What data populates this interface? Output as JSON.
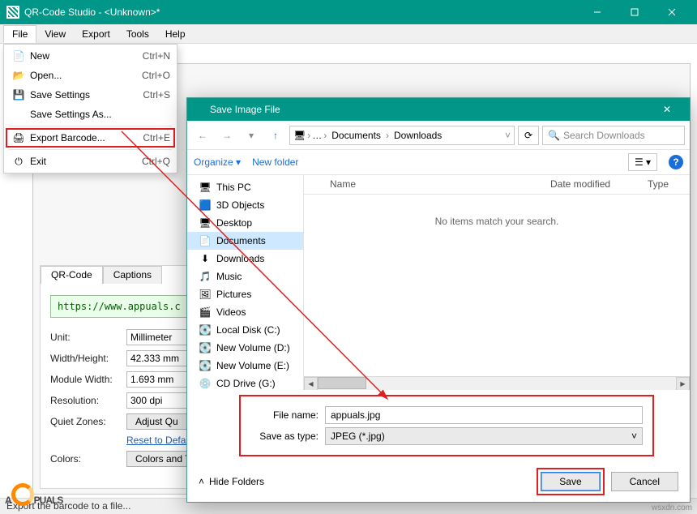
{
  "titlebar": {
    "title": "QR-Code Studio - <Unknown>*"
  },
  "menubar": [
    "File",
    "View",
    "Export",
    "Tools",
    "Help"
  ],
  "filemenu": {
    "new": "New",
    "new_sc": "Ctrl+N",
    "open": "Open...",
    "open_sc": "Ctrl+O",
    "save": "Save Settings",
    "save_sc": "Ctrl+S",
    "saveas": "Save Settings As...",
    "export": "Export Barcode...",
    "export_sc": "Ctrl+E",
    "exit": "Exit",
    "exit_sc": "Ctrl+Q"
  },
  "tabs": {
    "qr": "QR-Code",
    "cap": "Captions"
  },
  "url": "https://www.appuals.c",
  "props": {
    "unit_l": "Unit:",
    "unit_v": "Millimeter",
    "wh_l": "Width/Height:",
    "wh_v": "42.333 mm",
    "mw_l": "Module Width:",
    "mw_v": "1.693 mm",
    "res_l": "Resolution:",
    "res_v": "300 dpi",
    "qz_l": "Quiet Zones:",
    "qz_btn": "Adjust Qu",
    "reset": "Reset to Default Se",
    "col_l": "Colors:",
    "col_btn": "Colors and T"
  },
  "status": "Export the barcode to a file...",
  "dialog": {
    "title": "Save Image File",
    "crumbs": [
      "Documents",
      "Downloads"
    ],
    "search_ph": "Search Downloads",
    "organize": "Organize",
    "newfolder": "New folder",
    "cols": {
      "name": "Name",
      "date": "Date modified",
      "type": "Type"
    },
    "empty": "No items match your search.",
    "fn_l": "File name:",
    "fn_v": "appuals.jpg",
    "st_l": "Save as type:",
    "st_v": "JPEG (*.jpg)",
    "hide": "Hide Folders",
    "save": "Save",
    "cancel": "Cancel",
    "tree": [
      {
        "k": "thispc",
        "label": "This PC"
      },
      {
        "k": "3d",
        "label": "3D Objects"
      },
      {
        "k": "desktop",
        "label": "Desktop"
      },
      {
        "k": "documents",
        "label": "Documents"
      },
      {
        "k": "downloads",
        "label": "Downloads"
      },
      {
        "k": "music",
        "label": "Music"
      },
      {
        "k": "pictures",
        "label": "Pictures"
      },
      {
        "k": "videos",
        "label": "Videos"
      },
      {
        "k": "ldc",
        "label": "Local Disk (C:)"
      },
      {
        "k": "nvd",
        "label": "New Volume (D:)"
      },
      {
        "k": "nve",
        "label": "New Volume (E:)"
      },
      {
        "k": "cdg",
        "label": "CD Drive (G:)"
      }
    ]
  },
  "watermark": {
    "brand_a": "A",
    "brand_b": "PUALS"
  },
  "srcnote": "wsxdn.com"
}
